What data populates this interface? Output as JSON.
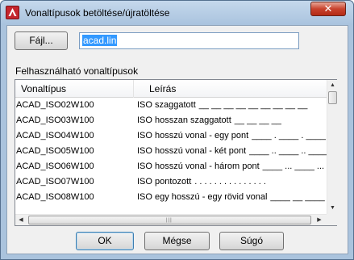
{
  "window": {
    "title": "Vonaltípusok betöltése/újratöltése",
    "close_glyph": "✕"
  },
  "file": {
    "button_label": "Fájl...",
    "value": "acad.lin"
  },
  "available_label": "Felhasználható vonaltípusok",
  "list": {
    "columns": [
      "Vonaltípus",
      "Leírás"
    ],
    "rows": [
      {
        "name": "ACAD_ISO02W100",
        "desc": "ISO szaggatott",
        "pattern": "__ __ __ __ __ __ __ __ __"
      },
      {
        "name": "ACAD_ISO03W100",
        "desc": "ISO hosszan szaggatott",
        "pattern": "__     __     __     __"
      },
      {
        "name": "ACAD_ISO04W100",
        "desc": "ISO hosszú vonal - egy pont",
        "pattern": "____ . ____ . ____"
      },
      {
        "name": "ACAD_ISO05W100",
        "desc": "ISO hosszú vonal - két pont",
        "pattern": "____ .. ____ .. ____"
      },
      {
        "name": "ACAD_ISO06W100",
        "desc": "ISO hosszú vonal - három pont",
        "pattern": "____ ... ____ ..."
      },
      {
        "name": "ACAD_ISO07W100",
        "desc": "ISO pontozott",
        "pattern": ". . . . . . . . . . . . . . ."
      },
      {
        "name": "ACAD_ISO08W100",
        "desc": "ISO egy hosszú - egy rövid vonal",
        "pattern": "____ __ ____"
      }
    ]
  },
  "scroll": {
    "up": "▲",
    "down": "▼",
    "left": "◀",
    "right": "▶",
    "grip": "|||"
  },
  "buttons": {
    "ok": "OK",
    "cancel": "Mégse",
    "help": "Súgó"
  }
}
